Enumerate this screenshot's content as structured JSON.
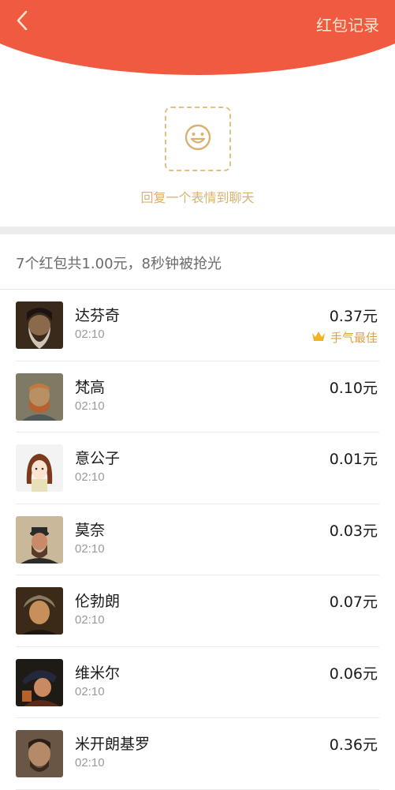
{
  "header": {
    "back_icon": "chevron-left-icon",
    "record_link": "红包记录",
    "bg_color": "#ef5a40"
  },
  "reply": {
    "icon": "smiley-icon",
    "text": "回复一个表情到聊天"
  },
  "summary": "7个红包共1.00元，8秒钟被抢光",
  "records": [
    {
      "name": "达芬奇",
      "time": "02:10",
      "amount": "0.37元",
      "best": "手气最佳"
    },
    {
      "name": "梵高",
      "time": "02:10",
      "amount": "0.10元"
    },
    {
      "name": "意公子",
      "time": "02:10",
      "amount": "0.01元"
    },
    {
      "name": "莫奈",
      "time": "02:10",
      "amount": "0.03元"
    },
    {
      "name": "伦勃朗",
      "time": "02:10",
      "amount": "0.07元"
    },
    {
      "name": "维米尔",
      "time": "02:10",
      "amount": "0.06元"
    },
    {
      "name": "米开朗基罗",
      "time": "02:10",
      "amount": "0.36元"
    }
  ]
}
